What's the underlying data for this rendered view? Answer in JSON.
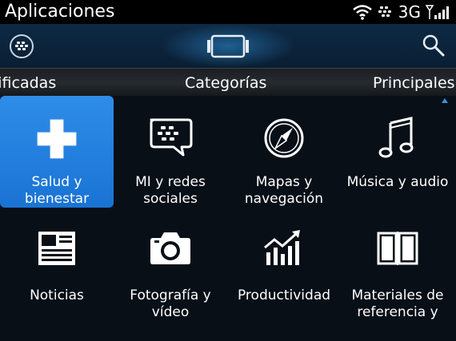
{
  "status_bar": {
    "app_title": "Aplicaciones",
    "network": "3G"
  },
  "tabs": {
    "left": "lificadas",
    "center": "Categorías",
    "right": "Principales"
  },
  "categories": [
    {
      "label": "Salud y\nbienestar",
      "icon": "plus-icon"
    },
    {
      "label": "MI y redes\nsociales",
      "icon": "bbm-chat-icon"
    },
    {
      "label": "Mapas y\nnavegación",
      "icon": "compass-icon"
    },
    {
      "label": "Música y audio",
      "icon": "music-note-icon"
    },
    {
      "label": "Noticias",
      "icon": "newspaper-icon"
    },
    {
      "label": "Fotografía y\nvídeo",
      "icon": "camera-icon"
    },
    {
      "label": "Productividad",
      "icon": "growth-chart-icon"
    },
    {
      "label": "Materiales de\nreferencia y",
      "icon": "book-icon"
    }
  ],
  "colors": {
    "selected_tile": "#2681e0",
    "header": "#0d2a44",
    "background": "#080f17"
  }
}
